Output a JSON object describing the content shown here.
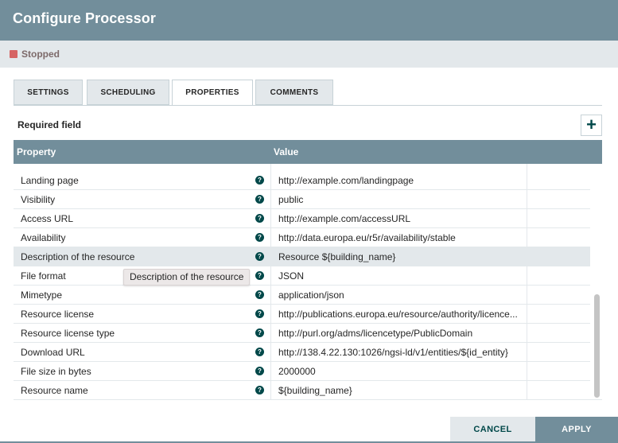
{
  "dialog": {
    "title": "Configure Processor"
  },
  "status": {
    "label": "Stopped",
    "color": "#d66464"
  },
  "tabs": [
    {
      "label": "SETTINGS",
      "active": false
    },
    {
      "label": "SCHEDULING",
      "active": false
    },
    {
      "label": "PROPERTIES",
      "active": true
    },
    {
      "label": "COMMENTS",
      "active": false
    }
  ],
  "properties": {
    "required_label": "Required field",
    "add_label": "+",
    "columns": {
      "property": "Property",
      "value": "Value"
    },
    "help_glyph": "?",
    "rows": [
      {
        "name": "Landing page",
        "value": "http://example.com/landingpage"
      },
      {
        "name": "Visibility",
        "value": "public"
      },
      {
        "name": "Access URL",
        "value": "http://example.com/accessURL"
      },
      {
        "name": "Availability",
        "value": "http://data.europa.eu/r5r/availability/stable"
      },
      {
        "name": "Description of the resource",
        "value": "Resource ${building_name}",
        "selected": true
      },
      {
        "name": "File format",
        "value": "JSON"
      },
      {
        "name": "Mimetype",
        "value": "application/json"
      },
      {
        "name": "Resource license",
        "value": "http://publications.europa.eu/resource/authority/licence..."
      },
      {
        "name": "Resource license type",
        "value": "http://purl.org/adms/licencetype/PublicDomain"
      },
      {
        "name": "Download URL",
        "value": "http://138.4.22.130:1026/ngsi-ld/v1/entities/${id_entity}"
      },
      {
        "name": "File size in bytes",
        "value": "2000000"
      },
      {
        "name": "Resource name",
        "value": "${building_name}"
      }
    ],
    "tooltip": "Description of the resource"
  },
  "footer": {
    "cancel_label": "CANCEL",
    "apply_label": "APPLY"
  },
  "colors": {
    "header": "#728e9b",
    "accent": "#004849",
    "status_bar": "#e3e8eb"
  }
}
